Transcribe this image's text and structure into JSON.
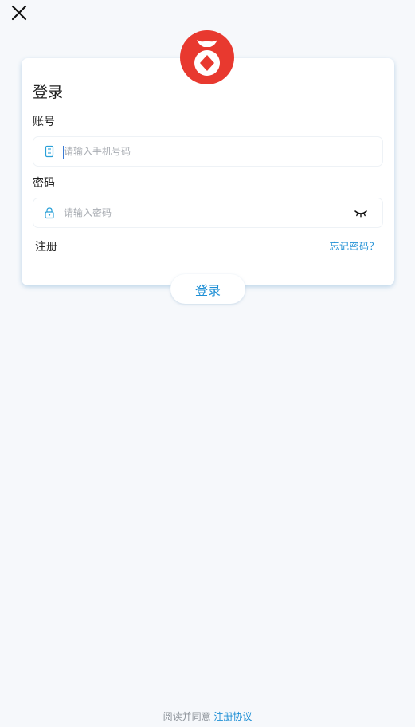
{
  "login_card": {
    "title": "登录",
    "account": {
      "label": "账号",
      "placeholder": "请输入手机号码",
      "value": ""
    },
    "password": {
      "label": "密码",
      "placeholder": "请输入密码",
      "value": ""
    },
    "register_label": "注册",
    "forgot_label": "忘记密码？"
  },
  "login_button_label": "登录",
  "footer": {
    "agreement_prefix": "阅读并同意",
    "agreement_link": "注册协议"
  },
  "colors": {
    "accent": "#1e8fd5",
    "logo_red": "#e8392f",
    "background": "#f6f8fb"
  },
  "icons": {
    "close": "close-icon",
    "logo": "app-logo",
    "account": "phone-icon",
    "password": "lock-icon",
    "eye": "eye-closed-icon"
  }
}
